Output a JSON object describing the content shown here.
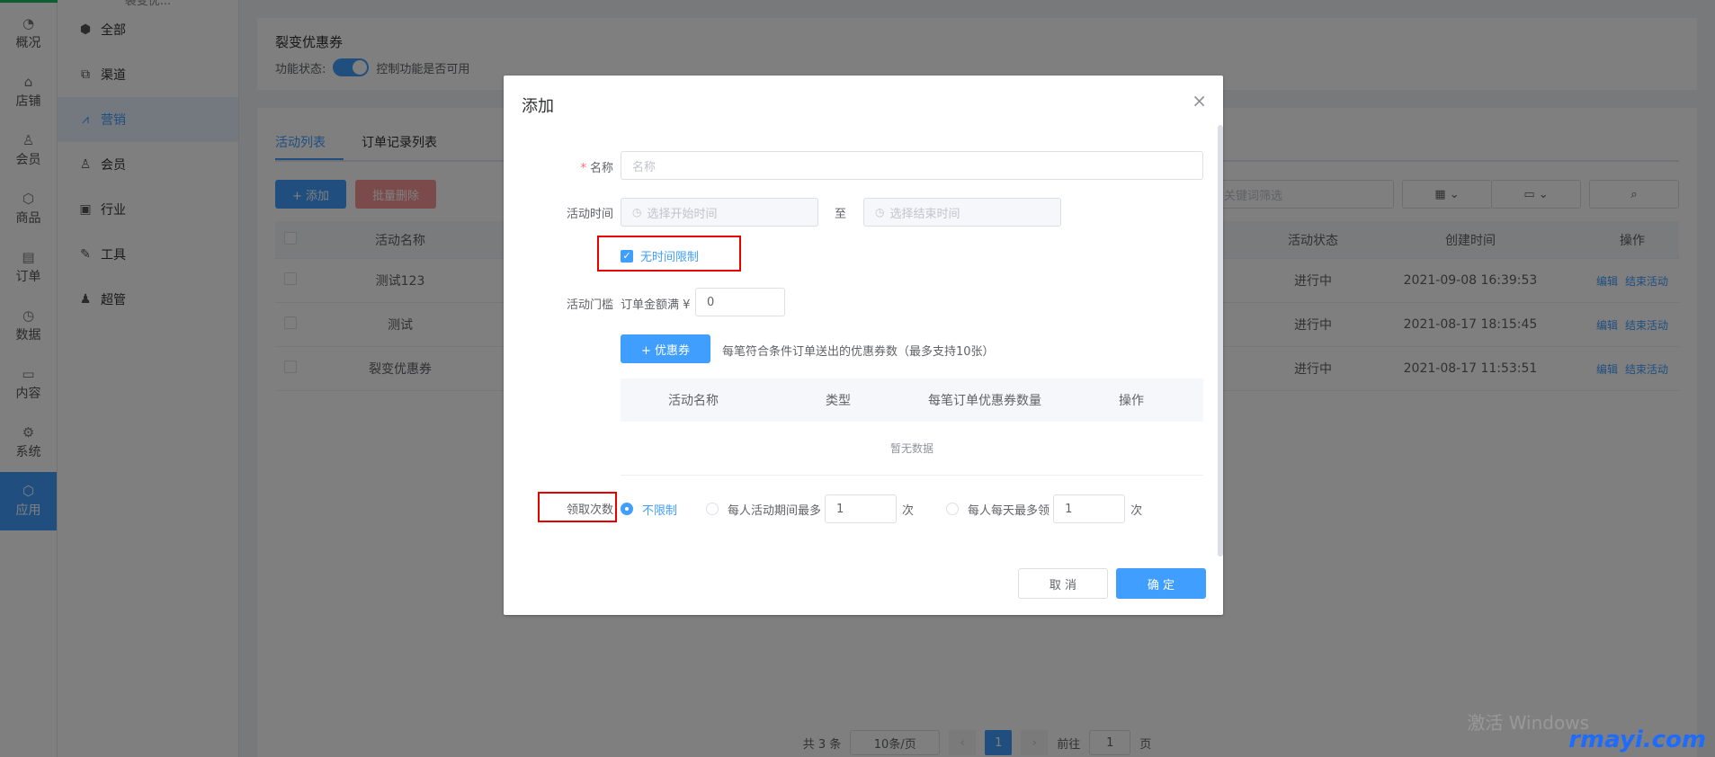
{
  "rail": {
    "items": [
      {
        "label": "概况",
        "icon": "dashboard-icon"
      },
      {
        "label": "店铺",
        "icon": "store-icon"
      },
      {
        "label": "会员",
        "icon": "user-icon"
      },
      {
        "label": "商品",
        "icon": "box-icon"
      },
      {
        "label": "订单",
        "icon": "order-icon"
      },
      {
        "label": "数据",
        "icon": "chart-icon"
      },
      {
        "label": "内容",
        "icon": "content-icon"
      },
      {
        "label": "系统",
        "icon": "gear-icon"
      },
      {
        "label": "应用",
        "icon": "app-icon"
      }
    ],
    "active": "应用"
  },
  "submenu": {
    "title": "裂变优...",
    "items": [
      {
        "label": "全部",
        "icon": "cube-icon"
      },
      {
        "label": "渠道",
        "icon": "channel-icon"
      },
      {
        "label": "营销",
        "icon": "marketing-icon"
      },
      {
        "label": "会员",
        "icon": "user-icon"
      },
      {
        "label": "行业",
        "icon": "briefcase-icon"
      },
      {
        "label": "工具",
        "icon": "wrench-icon"
      },
      {
        "label": "超管",
        "icon": "admin-icon"
      }
    ],
    "active": "营销"
  },
  "page": {
    "title": "裂变优惠券",
    "status_label": "功能状态:",
    "status_hint": "控制功能是否可用",
    "tabs": [
      "活动列表",
      "订单记录列表"
    ],
    "add_button": "+ 添加",
    "batch_delete_button": "批量删除",
    "search_placeholder": "关键词筛选",
    "table": {
      "headers": [
        "活动名称",
        "活动状态",
        "创建时间",
        "操作"
      ],
      "rows": [
        {
          "name": "测试123",
          "status": "进行中",
          "created": "2021-09-08 16:39:53"
        },
        {
          "name": "测试",
          "status": "进行中",
          "created": "2021-08-17 18:15:45"
        },
        {
          "name": "裂变优惠券",
          "status": "进行中",
          "created": "2021-08-17 11:53:51"
        }
      ],
      "action_edit": "编辑",
      "action_end": "结束活动"
    },
    "pager": {
      "total": "共 3 条",
      "page_size": "10条/页",
      "current": "1",
      "goto_prefix": "前往",
      "goto_value": "1",
      "goto_suffix": "页"
    }
  },
  "watermark": {
    "line1": "激活 Windows",
    "line2": "rmayi.com"
  },
  "dialog": {
    "title": "添加",
    "name_label": "名称",
    "name_placeholder": "名称",
    "time_label": "活动时间",
    "start_placeholder": "选择开始时间",
    "to": "至",
    "end_placeholder": "选择结束时间",
    "no_time_limit": "无时间限制",
    "threshold_label": "活动门槛",
    "threshold_prefix": "订单金额满 ¥",
    "threshold_value": "0",
    "coupon_button": "+ 优惠券",
    "coupon_hint": "每笔符合条件订单送出的优惠券数（最多支持10张）",
    "coupon_table_headers": [
      "活动名称",
      "类型",
      "每笔订单优惠券数量",
      "操作"
    ],
    "coupon_table_empty": "暂无数据",
    "limit_label": "领取次数",
    "limit_options": {
      "unlimited": "不限制",
      "per_activity": "每人活动期间最多",
      "per_activity_value": "1",
      "per_day": "每人每天最多领",
      "per_day_value": "1",
      "unit": "次"
    },
    "cancel_button": "取 消",
    "ok_button": "确 定"
  }
}
